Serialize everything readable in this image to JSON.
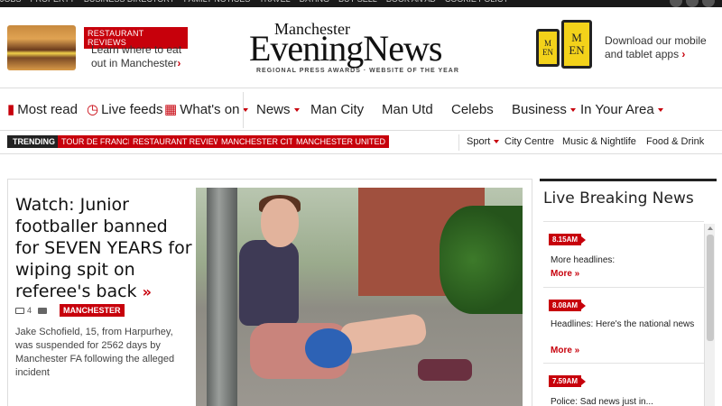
{
  "topbar": {
    "links": [
      "JOBS",
      "PROPERTY",
      "BUSINESS DIRECTORY",
      "FAMILY NOTICES",
      "TRAVEL",
      "DATING",
      "BUY SELL",
      "BOOK AN AD",
      "COOKIE POLICY"
    ]
  },
  "promo_left": {
    "tag": "RESTAURANT REVIEWS",
    "text": "Learn where to eat out in Manchester",
    "chevron": "›"
  },
  "logo": {
    "line1": "Manchester",
    "line2": "EveningNews",
    "tagline": "REGIONAL PRESS AWARDS · WEBSITE OF THE YEAR"
  },
  "promo_right": {
    "phone_small": "M EN",
    "phone_large": "M EN",
    "text": "Download our mobile and tablet apps",
    "chevron": "›"
  },
  "mainnav": {
    "most_read": "Most read",
    "live_feeds": "Live feeds",
    "whats_on": "What's on",
    "news": "News",
    "man_city": "Man City",
    "man_utd": "Man Utd",
    "celebs": "Celebs",
    "business": "Business",
    "in_your_area": "In Your Area"
  },
  "trending": {
    "label": "TRENDING",
    "chips": [
      "TOUR DE FRANCE",
      "RESTAURANT REVIEWS",
      "MANCHESTER CITY",
      "MANCHESTER UNITED"
    ],
    "sub": {
      "sport": "Sport",
      "city_centre": "City Centre",
      "music": "Music & Nightlife",
      "food": "Food & Drink"
    }
  },
  "story": {
    "headline": "Watch: Junior footballer banned for SEVEN YEARS for wiping spit on referee's back",
    "chevron": "»",
    "comments": "4",
    "location": "MANCHESTER",
    "summary": "Jake Schofield, 15, from Harpurhey, was suspended for 2562 days by Manchester FA following the alleged incident"
  },
  "sidebar": {
    "title": "Live Breaking News",
    "more_label": "More »",
    "entries": [
      {
        "time": "8.15AM",
        "text": "More headlines:"
      },
      {
        "time": "8.08AM",
        "text": "Headlines: Here's the national news"
      },
      {
        "time": "7.59AM",
        "text": "Police: Sad news just in..."
      }
    ]
  },
  "colors": {
    "brand_red": "#c7000b",
    "dark": "#222222",
    "app_yellow": "#f3d21a"
  }
}
